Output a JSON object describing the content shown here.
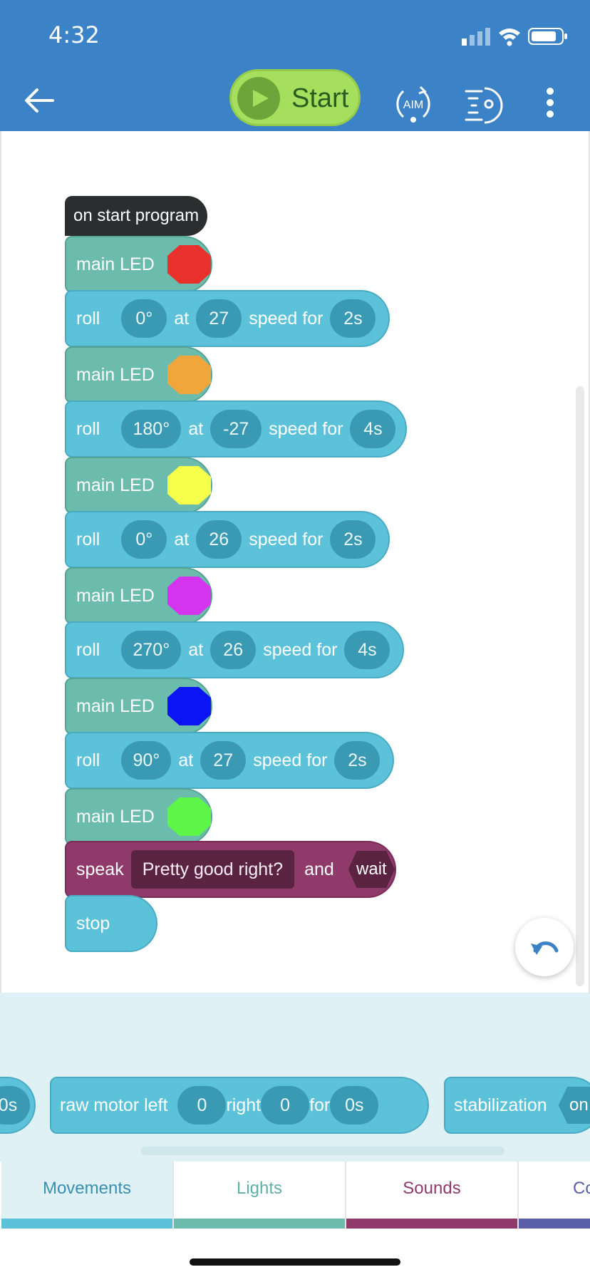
{
  "status_bar": {
    "time": "4:32"
  },
  "header": {
    "start_label": "Start",
    "aim_label": "AIM",
    "icons": [
      "back-arrow-icon",
      "play-icon",
      "aim-icon",
      "drive-icon",
      "more-vertical-icon"
    ],
    "background_color": "#3b82c6",
    "start_color": "#a6df5e"
  },
  "program": {
    "start_block": "on start program",
    "led_label": "main LED",
    "roll_label": "roll",
    "at_label": "at",
    "speed_for_label": "speed for",
    "led_blocks": [
      {
        "color": "#e8312b"
      },
      {
        "color": "#f0a63a"
      },
      {
        "color": "#f6ff4a"
      },
      {
        "color": "#d534ef"
      },
      {
        "color": "#0a14f5"
      },
      {
        "color": "#5ef549"
      }
    ],
    "roll_blocks": [
      {
        "heading": "0°",
        "speed": "27",
        "duration": "2s"
      },
      {
        "heading": "180°",
        "speed": "-27",
        "duration": "4s"
      },
      {
        "heading": "0°",
        "speed": "26",
        "duration": "2s"
      },
      {
        "heading": "270°",
        "speed": "26",
        "duration": "4s"
      },
      {
        "heading": "90°",
        "speed": "27",
        "duration": "2s"
      }
    ],
    "speak_block": {
      "label": "speak",
      "text": "Pretty good right?",
      "and_label": "and",
      "wait_label": "wait"
    },
    "stop_label": "stop"
  },
  "palette": {
    "partial_value": "0s",
    "raw_motor": {
      "label": "raw motor left",
      "left": "0",
      "right_label": "right",
      "right": "0",
      "for_label": "for",
      "duration": "0s"
    },
    "stabilization": {
      "label": "stabilization",
      "value": "on"
    }
  },
  "tabs": [
    {
      "label": "Movements",
      "color": "#5cc2da",
      "text_color": "#3a8fb0",
      "active": true
    },
    {
      "label": "Lights",
      "color": "#6bbcad",
      "text_color": "#5fb0a8"
    },
    {
      "label": "Sounds",
      "color": "#8f3a6a",
      "text_color": "#8f3a6a"
    },
    {
      "label": "Co",
      "color": "#5b5fa8",
      "text_color": "#5b5fa8"
    }
  ]
}
